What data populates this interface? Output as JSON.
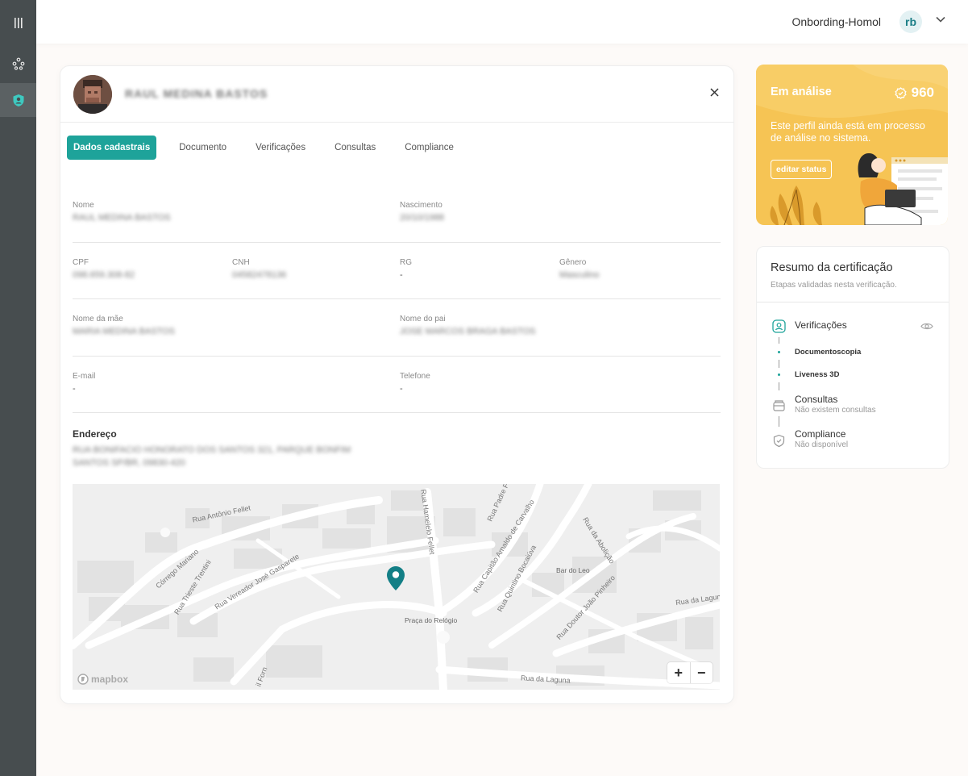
{
  "topbar": {
    "org": "Onbording-Homol",
    "user_initials": "rb"
  },
  "profile": {
    "name": "RAUL MEDINA BASTOS",
    "tabs": [
      "Dados cadastrais",
      "Documento",
      "Verificações",
      "Consultas",
      "Compliance"
    ],
    "active_tab": "Dados cadastrais"
  },
  "fields": {
    "nome": {
      "label": "Nome",
      "value": "RAUL MEDINA BASTOS"
    },
    "nascimento": {
      "label": "Nascimento",
      "value": "20/10/1988"
    },
    "cpf": {
      "label": "CPF",
      "value": "098.659.308-82"
    },
    "cnh": {
      "label": "CNH",
      "value": "04582478136"
    },
    "rg": {
      "label": "RG",
      "value": "-"
    },
    "genero": {
      "label": "Gênero",
      "value": "Masculino"
    },
    "mae": {
      "label": "Nome da mãe",
      "value": "MARIA MEDINA BASTOS"
    },
    "pai": {
      "label": "Nome do pai",
      "value": "JOSE MARCOS BRAGA BASTOS"
    },
    "email": {
      "label": "E-mail",
      "value": "-"
    },
    "telefone": {
      "label": "Telefone",
      "value": "-"
    }
  },
  "address": {
    "title": "Endereço",
    "line1": "RUA BONIFACIO HONORATO DOS SANTOS 321, PARQUE BONFIM",
    "line2": "SANTOS SP/BR, 09830-420"
  },
  "map": {
    "streets": [
      "Rua Antônio Fellet",
      "Córrego Mariano",
      "Rua Trieste Trentini",
      "Rua Vereador José Gasparete",
      "Rua Hamelelo Fellet",
      "Rua Padre Fre",
      "Rua Capitão Arnaldo de Carvalho",
      "Rua Quintino Bocaiúva",
      "Rua da Abolição",
      "Rua Doutor João Pinheiro",
      "Rua da Laguna",
      "Rua da Laguna",
      "il Forn"
    ],
    "places": [
      "Bar do Leo",
      "Praça do Relógio"
    ],
    "logo": "mapbox",
    "zoom_in": "+",
    "zoom_out": "−",
    "marker_color": "#137f86"
  },
  "status": {
    "title": "Em análise",
    "score": "960",
    "message": "Este perfil ainda está em processo de análise no sistema.",
    "button": "editar status",
    "color": "#f6c454"
  },
  "summary": {
    "title": "Resumo da certificação",
    "subtitle": "Etapas validadas nesta verificação.",
    "verificacoes": "Verificações",
    "sub1": "Documentoscopia",
    "sub2": "Liveness 3D",
    "consultas": "Consultas",
    "consultas_sub": "Não existem consultas",
    "compliance": "Compliance",
    "compliance_sub": "Não disponível"
  },
  "accent": "#1ea39a"
}
